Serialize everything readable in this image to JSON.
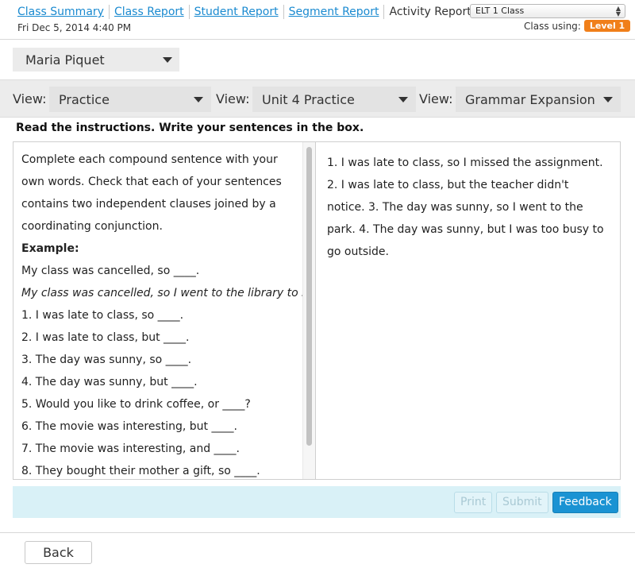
{
  "nav": {
    "links": [
      "Class Summary",
      "Class Report",
      "Student Report",
      "Segment Report"
    ],
    "current": "Activity Report",
    "timestamp": "Fri Dec 5, 2014 4:40 PM",
    "class_select": "ELT 1 Class",
    "class_using_label": "Class using:",
    "level_badge": "Level 1"
  },
  "student": {
    "name": "Maria Piquet"
  },
  "views": [
    {
      "label": "View:",
      "value": "Practice"
    },
    {
      "label": "View:",
      "value": "Unit 4 Practice"
    },
    {
      "label": "View:",
      "value": "Grammar Expansion"
    }
  ],
  "instructions": "Read the instructions. Write your sentences in the box.",
  "left_pane": {
    "intro": "Complete each compound sentence with your own words. Check that each of your sentences contains two independent clauses joined by a coordinating conjunction.",
    "example_label": "Example:",
    "example_prompt": "My class was cancelled, so ____.",
    "example_answer": "My class was cancelled, so I went to the library to study.",
    "items": [
      "1. I was late to class, so ____.",
      "2. I was late to class, but ____.",
      "3. The day was sunny, so ____.",
      "4. The day was sunny, but ____.",
      "5. Would you like to drink coffee, or ____?",
      "6. The movie was interesting, but ____.",
      "7. The movie was interesting, and ____.",
      "8. They bought their mother a gift, so ____."
    ]
  },
  "right_pane": {
    "answer": "1. I was late to class, so I missed the assignment. 2. I was late to class, but the teacher didn't notice. 3. The day was sunny, so I went to the park. 4. The day was sunny, but I was too busy to go outside."
  },
  "actions": {
    "print": "Print",
    "submit": "Submit",
    "feedback": "Feedback"
  },
  "footer": {
    "back": "Back"
  },
  "colors": {
    "link": "#1a8ad0",
    "badge": "#f07f1a",
    "primary": "#1a93d3",
    "action_bar": "#d9f1f7"
  }
}
